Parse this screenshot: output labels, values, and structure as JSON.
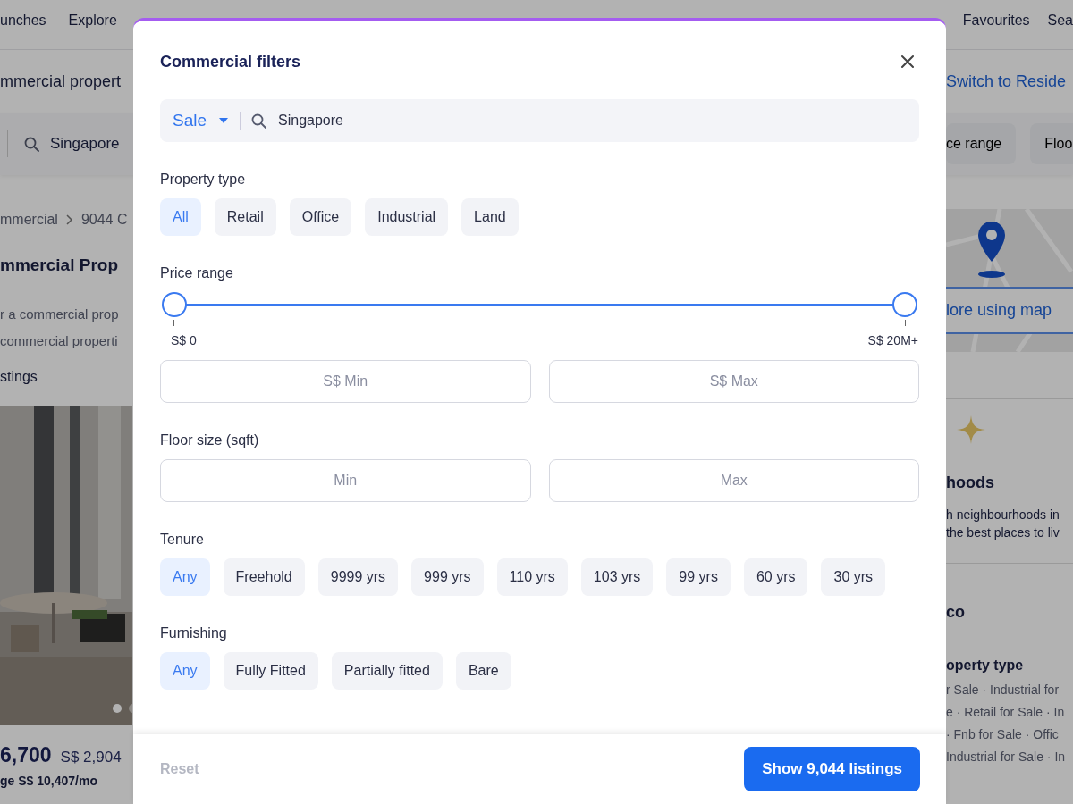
{
  "background_page": {
    "nav": [
      "unches",
      "Explore"
    ],
    "nav_right": [
      "Favourites",
      "Sea"
    ],
    "page_title": "mmercial propert",
    "switch_link": "Switch to Reside",
    "search_location": "Singapore",
    "filter_chips": [
      "ce range",
      "Floo"
    ],
    "breadcrumb": [
      "mmercial",
      "9044 C"
    ],
    "heading": "mmercial Prop",
    "description": [
      "r a commercial prop",
      "commercial properti"
    ],
    "listing_count": "stings",
    "listing": {
      "carousel_dots": [
        {
          "selected": true
        },
        {
          "selected": false
        }
      ],
      "price": "6,700",
      "price_psf": "S$ 2,904",
      "mortgage": "ge S$ 10,407/mo"
    },
    "map_card": {
      "label": "lore using map"
    },
    "neighbourhoods": {
      "title": "hoods",
      "lines": [
        "h neighbourhoods in",
        "the best places to liv"
      ]
    },
    "section_title": "co",
    "property_type_links": {
      "title": "operty type",
      "lines": [
        "r Sale · Industrial for",
        "e · Retail for Sale · In",
        "· Fnb for Sale · Offic",
        "Industrial for Sale · In"
      ]
    }
  },
  "modal": {
    "title": "Commercial filters",
    "listing_type": "Sale",
    "location": "Singapore",
    "sections": [
      {
        "kind": "chips",
        "label": "Property type",
        "options": [
          {
            "label": "All",
            "selected": true
          },
          {
            "label": "Retail",
            "selected": false
          },
          {
            "label": "Office",
            "selected": false
          },
          {
            "label": "Industrial",
            "selected": false
          },
          {
            "label": "Land",
            "selected": false
          }
        ]
      },
      {
        "kind": "range",
        "label": "Price range",
        "thumbs": [
          {
            "level": 0
          },
          {
            "level": 1
          }
        ],
        "min_label": "S$ 0",
        "max_label": "S$ 20M+",
        "inputs": [
          {
            "placeholder": "S$ Min"
          },
          {
            "placeholder": "S$ Max"
          }
        ]
      },
      {
        "kind": "inputs",
        "label": "Floor size (sqft)",
        "inputs": [
          {
            "placeholder": "Min"
          },
          {
            "placeholder": "Max"
          }
        ]
      },
      {
        "kind": "chips",
        "label": "Tenure",
        "options": [
          {
            "label": "Any",
            "selected": true
          },
          {
            "label": "Freehold",
            "selected": false
          },
          {
            "label": "9999 yrs",
            "selected": false
          },
          {
            "label": "999 yrs",
            "selected": false
          },
          {
            "label": "110 yrs",
            "selected": false
          },
          {
            "label": "103 yrs",
            "selected": false
          },
          {
            "label": "99 yrs",
            "selected": false
          },
          {
            "label": "60 yrs",
            "selected": false
          },
          {
            "label": "30 yrs",
            "selected": false
          }
        ]
      },
      {
        "kind": "chips",
        "label": "Furnishing",
        "options": [
          {
            "label": "Any",
            "selected": true
          },
          {
            "label": "Fully Fitted",
            "selected": false
          },
          {
            "label": "Partially fitted",
            "selected": false
          },
          {
            "label": "Bare",
            "selected": false
          }
        ]
      }
    ],
    "footer": {
      "reset": {
        "label": "Reset",
        "disabled": true
      },
      "submit": "Show 9,044 listings"
    }
  }
}
